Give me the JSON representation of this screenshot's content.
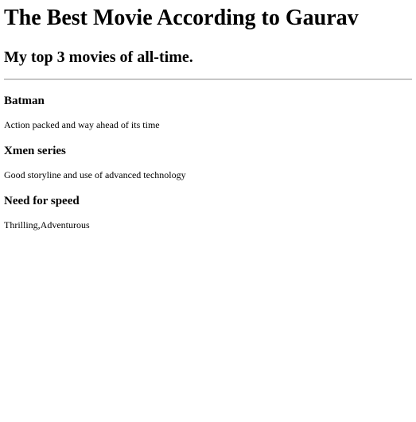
{
  "header": {
    "title": "The Best Movie According to Gaurav",
    "subtitle": "My top 3 movies of all-time."
  },
  "movies": [
    {
      "name": "Batman",
      "description": "Action packed and way ahead of its time"
    },
    {
      "name": "Xmen series",
      "description": "Good storyline and use of advanced technology"
    },
    {
      "name": "Need for speed",
      "description": "Thrilling,Adventurous"
    }
  ]
}
